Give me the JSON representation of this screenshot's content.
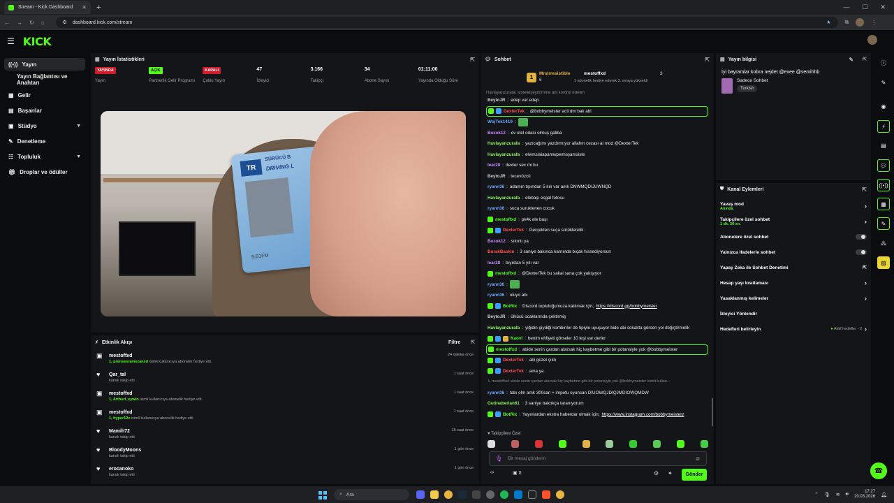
{
  "browser": {
    "tab_title": "Stream - Kick Dashboard",
    "url": "dashboard.kick.com/stream"
  },
  "logo": "KICK",
  "sidebar": {
    "items": [
      {
        "label": "Yayın"
      },
      {
        "label": "Yayın Bağlantısı ve Anahtarı"
      },
      {
        "label": "Gelir"
      },
      {
        "label": "Başarılar"
      },
      {
        "label": "Stüdyo"
      },
      {
        "label": "Denetleme"
      },
      {
        "label": "Topluluk"
      },
      {
        "label": "Droplar ve ödüller"
      }
    ]
  },
  "stats": {
    "title": "Yayın İstatistikleri",
    "items": [
      {
        "value": "YAYINDA",
        "label": "Yayın",
        "kind": "red"
      },
      {
        "value": "AÇIK",
        "label": "Partnerlik Gelir Programı",
        "kind": "green"
      },
      {
        "value": "KAPALI",
        "label": "Çoklu Yayın",
        "kind": "red"
      },
      {
        "value": "47",
        "label": "İzleyici",
        "kind": "text"
      },
      {
        "value": "3.166",
        "label": "Takipçi",
        "kind": "text"
      },
      {
        "value": "34",
        "label": "Abone Sayısı",
        "kind": "text"
      },
      {
        "value": "01:11:00",
        "label": "Yayında Olduğu Süre",
        "kind": "text"
      }
    ]
  },
  "video": {
    "card_country": "TR",
    "card_line1": "SÜRÜCÜ B",
    "card_line2": "DRIVING L",
    "card_number": "9.B1FM"
  },
  "activity": {
    "title": "Etkinlik Akışı",
    "filter": "Filtre",
    "items": [
      {
        "name": "mestoffxd",
        "highlight": "1, prensesramezanxd",
        "text": "isimli kullanıcıya abonelik hediye etti.",
        "time": "24 dakika önce",
        "icon": "gift"
      },
      {
        "name": "Qar_tal",
        "highlight": "",
        "text": "kanalı takip etti",
        "time": "1 saat önce",
        "icon": "heart"
      },
      {
        "name": "mestoffxd",
        "highlight": "1, Arthurl_eywin",
        "text": "isimli kullanıcıya abonelik hediye etti.",
        "time": "1 saat önce",
        "icon": "gift"
      },
      {
        "name": "mestoffxd",
        "highlight": "1, hyper12x",
        "text": "isimli kullanıcıya abonelik hediye etti.",
        "time": "1 saat önce",
        "icon": "gift"
      },
      {
        "name": "Mamih72",
        "highlight": "",
        "text": "kanalı takip etti",
        "time": "18 saat önce",
        "icon": "heart"
      },
      {
        "name": "BloodyMoons",
        "highlight": "",
        "text": "kanalı takip etti",
        "time": "1 gün önce",
        "icon": "heart"
      },
      {
        "name": "erocanoko",
        "highlight": "",
        "text": "kanalı takip etti",
        "time": "1 gün önce",
        "icon": "heart"
      }
    ]
  },
  "chat": {
    "title": "Sohbet",
    "pinned": {
      "user1": "MrsIrresistible",
      "count1": "6",
      "user2": "mestoffxd",
      "count2": "3",
      "note": "1 abonelik hediye ederek 3. sıraya yükseldi"
    },
    "top_cut": "Havlayanzurafa: sistelelşeyimmme abi kontrol edelim",
    "messages": [
      {
        "user": "BeytoJR",
        "color": "#cfd2d6",
        "text": "edep var edep",
        "hl": false,
        "badges": 0
      },
      {
        "user": "DexterTek",
        "color": "#ff4d4d",
        "text": "@bobbymeister acil dm bak abi",
        "hl": true,
        "badges": 2
      },
      {
        "user": "WojTek1419",
        "color": "#6fa8ff",
        "text": "",
        "hl": false,
        "badges": 0,
        "emote": true
      },
      {
        "user": "Bozok12",
        "color": "#c98bff",
        "text": "ev otel odası olmuş galiba",
        "hl": false,
        "badges": 0
      },
      {
        "user": "Havlayanzurafa",
        "color": "#8cf55a",
        "text": "yazıcağımı yazdırmıyor allahın cezası ai mod @DexterTek",
        "hl": false,
        "badges": 0
      },
      {
        "user": "Havlayanzurafa",
        "color": "#8cf55a",
        "text": "elwmsiaiapamwpwmsşamsisle",
        "hl": false,
        "badges": 0
      },
      {
        "user": "lear28",
        "color": "#c98bff",
        "text": "dexter sex mi bu",
        "hl": false,
        "badges": 0
      },
      {
        "user": "BeytoJR",
        "color": "#cfd2d6",
        "text": "tecevüzcü",
        "hl": false,
        "badges": 0
      },
      {
        "user": "ryann36",
        "color": "#6fa8ff",
        "text": "adamın tıpından 5 kılı var amk DNWMQDIJUWNQD",
        "hl": false,
        "badges": 0
      },
      {
        "user": "Havlayanzurafa",
        "color": "#8cf55a",
        "text": "elebaşı esgal fotosu",
        "hl": false,
        "badges": 0
      },
      {
        "user": "ryann36",
        "color": "#6fa8ff",
        "text": "suca suruklenen cocuk",
        "hl": false,
        "badges": 0
      },
      {
        "user": "mestoffxd",
        "color": "#53fc18",
        "text": "pk4k ele başı",
        "hl": false,
        "badges": 1
      },
      {
        "user": "DexterTek",
        "color": "#ff4d4d",
        "text": "Gerçekten suça sürüklendik",
        "hl": false,
        "badges": 2
      },
      {
        "user": "Bozok12",
        "color": "#c98bff",
        "text": "sıkıntı ya",
        "hl": false,
        "badges": 0
      },
      {
        "user": "BurakBaskin",
        "color": "#ff4d4d",
        "text": "3 saniye bakınca karnında bıçak hissediyorsun",
        "hl": false,
        "badges": 0
      },
      {
        "user": "lear28",
        "color": "#c98bff",
        "text": "bıyıktan 5 yılı var",
        "hl": false,
        "badges": 0
      },
      {
        "user": "mestoffxd",
        "color": "#53fc18",
        "text": "@DexterTek bu sakal sana çok yakışıyor",
        "hl": false,
        "badges": 1
      },
      {
        "user": "ryann36",
        "color": "#6fa8ff",
        "text": "",
        "hl": false,
        "badges": 0,
        "emote": true
      },
      {
        "user": "ryann36",
        "color": "#6fa8ff",
        "text": "oluyo abı",
        "hl": false,
        "badges": 0
      },
      {
        "user": "BotRix",
        "color": "#53fc18",
        "text": "Discord topluluğumuza katılmak için;",
        "link": "https://discord.gg/bobbymeister",
        "hl": false,
        "badges": 2
      },
      {
        "user": "BeytoJR",
        "color": "#cfd2d6",
        "text": "ülkücü ocaklarında çektirmiş",
        "hl": false,
        "badges": 0
      },
      {
        "user": "Havlayanzurafa",
        "color": "#8cf55a",
        "text": "yiğidin giydiği kombinler de tipiyle uyuşuyor bide abi sokakta görsen yol değiştirmelik",
        "hl": false,
        "badges": 0
      },
      {
        "user": "Kaovi",
        "color": "#53fc18",
        "text": "benim ehliyeti görseler 10 leşi var derler",
        "hl": false,
        "badges": 3
      },
      {
        "user": "mestoffxd",
        "color": "#53fc18",
        "text": "abide senin çardan atarsak hiç kaybetme gibi bir potansiyle yok @bobbymeister",
        "hl": true,
        "badges": 1
      },
      {
        "user": "DexterTek",
        "color": "#ff4d4d",
        "text": "abi güzel çıktı",
        "hl": false,
        "badges": 2
      },
      {
        "user": "DexterTek",
        "color": "#ff4d4d",
        "text": "ama ya",
        "hl": false,
        "badges": 2
      },
      {
        "user": "",
        "color": "#888",
        "text": "↳ mestoffxd: abide senin çardan atarsak hiç kaybetme gibi bir potansiyle yok @bobbymeister isimli kullan...",
        "hl": false,
        "badges": 0,
        "reply": true
      },
      {
        "user": "ryann36",
        "color": "#6fa8ff",
        "text": "tabı olm amk 300can + impetu oyuncan DIUOWQJDIQJMDIOWQMDW",
        "hl": false,
        "badges": 0
      },
      {
        "user": "Gutinaberlan61",
        "color": "#8cf55a",
        "text": "3 saniye baktıkça taranıyorum",
        "hl": false,
        "badges": 0
      },
      {
        "user": "BotRix",
        "color": "#53fc18",
        "text": "Yayınlardan ekstra haberdar olmak için;",
        "link": "https://www.instagram.com/bobbymeisterz",
        "hl": false,
        "badges": 2
      }
    ],
    "followers_label": "Takipçilere Özel",
    "input_placeholder": "Bir mesaj gönderin",
    "points": "0",
    "send": "Gönder"
  },
  "stream_info": {
    "title": "Yayın bilgisi",
    "stream_title": "İyi bayramlar kobra nejdet @exee @semihhb",
    "category": "Sadece Sohbet",
    "tag": "Turkish"
  },
  "channel_actions": {
    "title": "Kanal Eylemleri",
    "items": [
      {
        "label": "Yavaş mod",
        "sub": "Anında",
        "control": "chevron"
      },
      {
        "label": "Takipçilere özel sohbet",
        "sub": "1 dk. 30 sn.",
        "control": "chevron"
      },
      {
        "label": "Abonelere özel sohbet",
        "sub": "",
        "control": "toggle"
      },
      {
        "label": "Yalnızca ifadelerle sohbet",
        "sub": "",
        "control": "toggle"
      },
      {
        "label": "Yapay Zeka ile Sohbet Denetimi",
        "sub": "",
        "control": "external"
      },
      {
        "label": "Hesap yaşı kısıtlaması",
        "sub": "",
        "control": "chevron"
      },
      {
        "label": "Yasaklanmış kelimeler",
        "sub": "",
        "control": "chevron"
      },
      {
        "label": "İzleyici Yönlendir",
        "sub": "",
        "control": "none"
      },
      {
        "label": "Hedefleri belirleyin",
        "sub": "",
        "control": "goal"
      }
    ],
    "goal_status": "Aktif hedefler - 2"
  },
  "taskbar": {
    "search": "Ara",
    "time": "17:27",
    "date": "20.03.2026"
  },
  "colors": {
    "accent": "#53fc18",
    "live": "#d11d2b",
    "panel": "#141518"
  }
}
